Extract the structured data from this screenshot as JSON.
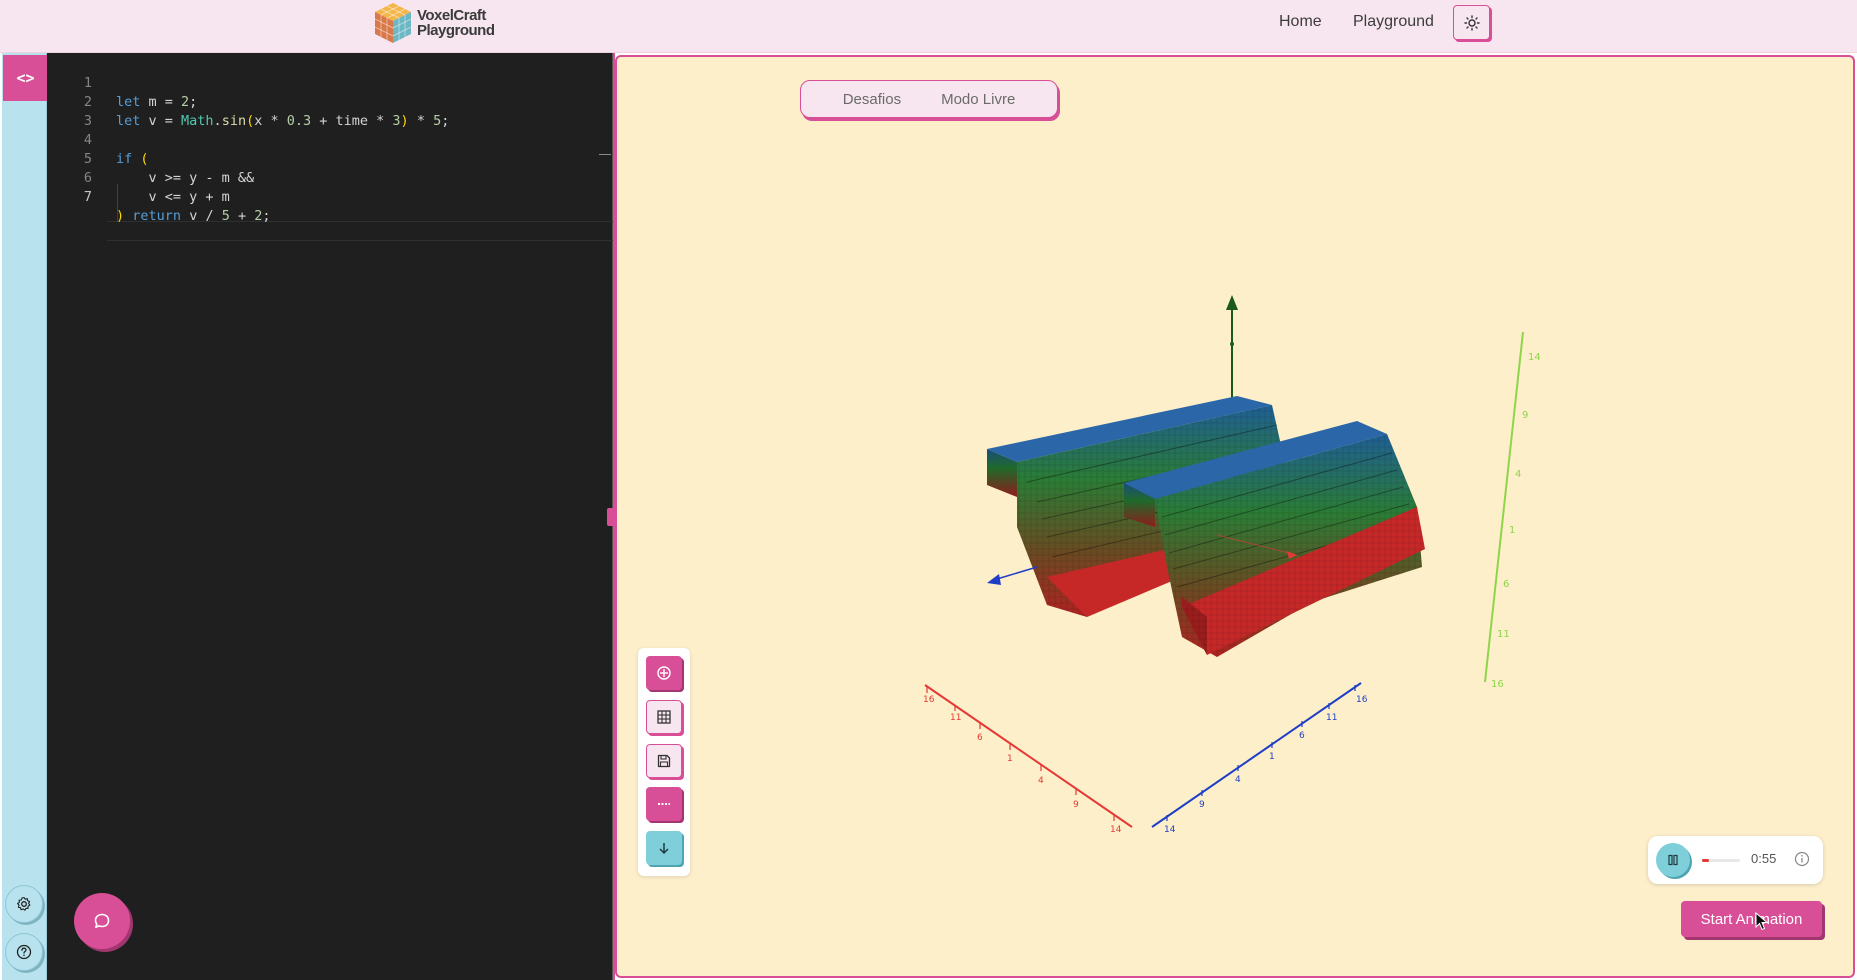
{
  "header": {
    "logo_line1": "VoxelCraft",
    "logo_line2": "Playground",
    "nav": [
      {
        "label": "Home"
      },
      {
        "label": "Playground"
      }
    ],
    "theme_icon": "sun-icon"
  },
  "sidebar": {
    "code_toggle_icon": "code-brackets-icon",
    "code_toggle_label": "<>",
    "settings_icon": "gear-icon",
    "help_icon": "help-circle-icon"
  },
  "editor": {
    "lines": [
      {
        "num": "1",
        "text": "let m = 2;"
      },
      {
        "num": "2",
        "text": "let v = Math.sin(x * 0.3 + time * 3) * 5;"
      },
      {
        "num": "3",
        "text": ""
      },
      {
        "num": "4",
        "text": "if ("
      },
      {
        "num": "5",
        "text": "    v >= y - m &&"
      },
      {
        "num": "6",
        "text": "    v <= y + m"
      },
      {
        "num": "7",
        "text": ") return v / 5 + 2;"
      }
    ],
    "active_line": "7",
    "chat_icon": "chat-bubble-icon"
  },
  "viewport": {
    "tabs": [
      {
        "label": "Desafios"
      },
      {
        "label": "Modo Livre"
      }
    ],
    "axes": {
      "x_color": "#e53935",
      "z_color": "#1e3ec8",
      "y_color": "#8fd54c",
      "x_ticks": [
        "16",
        "11",
        "6",
        "1",
        "4",
        "9",
        "14"
      ],
      "z_ticks": [
        "14",
        "9",
        "4",
        "1",
        "6",
        "11",
        "16"
      ],
      "y_ticks": [
        "14",
        "9",
        "4",
        "1",
        "6",
        "11",
        "16"
      ]
    },
    "voxel_colors": {
      "top": "#2b67a8",
      "mid": "#2e8a3a",
      "bottom": "#c62828"
    },
    "toolbar": [
      {
        "name": "crosshair-icon"
      },
      {
        "name": "grid-icon"
      },
      {
        "name": "save-icon"
      },
      {
        "name": "dotted-line-icon"
      },
      {
        "name": "arrow-down-icon"
      }
    ],
    "player": {
      "time": "0:55",
      "progress": 0.18,
      "play_icon": "pause-icon",
      "info_icon": "info-icon"
    },
    "start_button": "Start Animation"
  }
}
